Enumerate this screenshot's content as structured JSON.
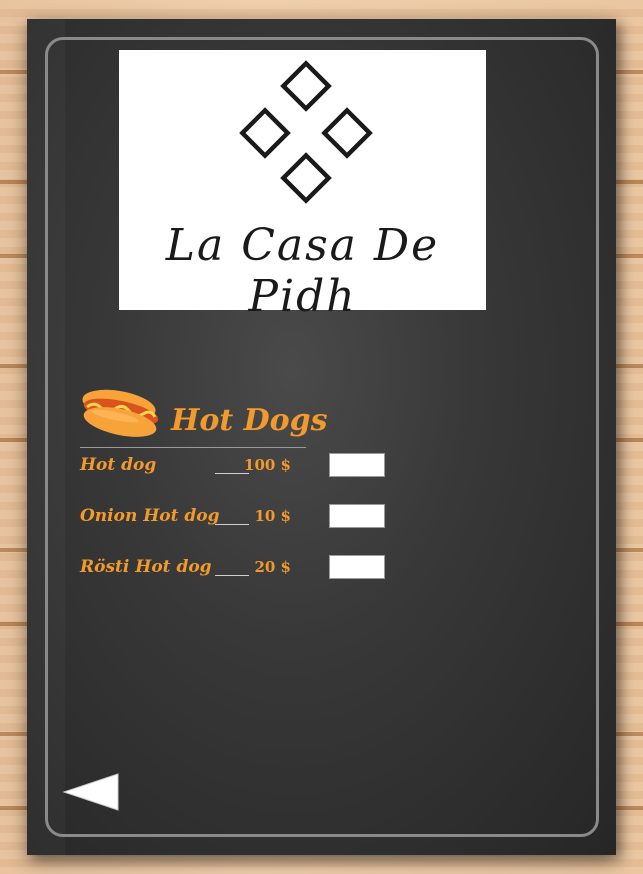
{
  "brand": {
    "name": "La Casa De Pidh"
  },
  "section": {
    "title": "Hot Dogs",
    "icon": "hotdog-icon"
  },
  "menu_items": [
    {
      "name": "Hot dog",
      "price": "100 $",
      "quantity": ""
    },
    {
      "name": "Onion Hot dog",
      "price": "10 $",
      "quantity": ""
    },
    {
      "name": "Rösti Hot dog",
      "price": "20 $",
      "quantity": ""
    }
  ],
  "navigation": {
    "back_icon": "back-triangle-icon"
  },
  "colors": {
    "accent": "#f29a2c",
    "board": "#333333",
    "frame": "#8a8a8a"
  }
}
